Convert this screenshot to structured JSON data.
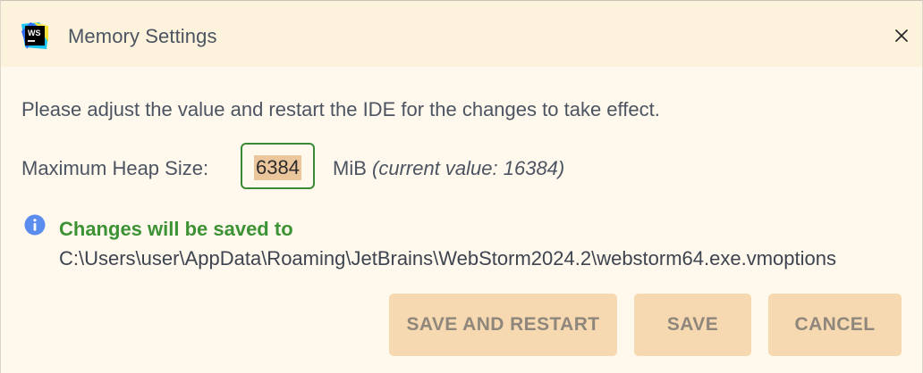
{
  "dialog": {
    "title": "Memory Settings",
    "app_icon_text": "WS",
    "close": "close-icon"
  },
  "body": {
    "instruction": "Please adjust the value and restart the IDE for the changes to take effect.",
    "heap": {
      "label": "Maximum Heap Size:",
      "value": "6384",
      "unit": "MiB",
      "current": "(current value: 16384)"
    },
    "info": {
      "icon": "info-icon",
      "title": "Changes will be saved to",
      "path": "C:\\Users\\user\\AppData\\Roaming\\JetBrains\\WebStorm2024.2\\webstorm64.exe.vmoptions"
    }
  },
  "buttons": {
    "save_and_restart": "SAVE AND RESTART",
    "save": "SAVE",
    "cancel": "CANCEL"
  },
  "colors": {
    "background": "#fff8ec",
    "titlebar": "#fdf3dd",
    "button": "#f6d8b1",
    "button_text": "#8f877c",
    "accent_green": "#3c9234",
    "info_blue": "#5b8def",
    "selection": "#ebc69c"
  }
}
